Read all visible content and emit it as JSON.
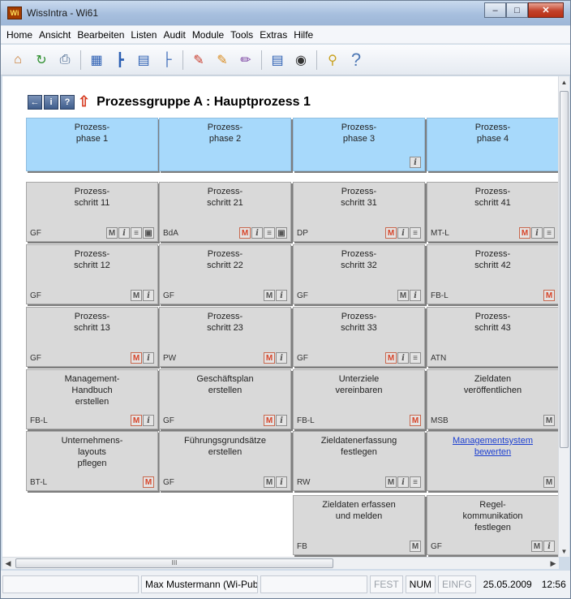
{
  "window": {
    "title": "WissIntra - Wi61"
  },
  "menu": [
    "Home",
    "Ansicht",
    "Bearbeiten",
    "Listen",
    "Audit",
    "Module",
    "Tools",
    "Extras",
    "Hilfe"
  ],
  "toolbar_icons": [
    "home-icon",
    "refresh-icon",
    "print-icon",
    "grid-view-icon",
    "tree-view-icon",
    "list-view-icon",
    "hierarchy-view-icon",
    "pencil-red-icon",
    "pencil-orange-icon",
    "pencil-lines-icon",
    "edit-table-icon",
    "binoculars-icon",
    "key-icon",
    "help-icon"
  ],
  "page": {
    "title": "Prozessgruppe A :  Hauptprozess 1"
  },
  "tiles": [
    {
      "label": "Prozess-\nphase 1",
      "code": "",
      "icons": [],
      "type": "phase"
    },
    {
      "label": "Prozess-\nphase 2",
      "code": "",
      "icons": [],
      "type": "phase"
    },
    {
      "label": "Prozess-\nphase 3",
      "code": "",
      "icons": [
        "i"
      ],
      "type": "phase"
    },
    {
      "label": "Prozess-\nphase 4",
      "code": "",
      "icons": [],
      "type": "phase"
    },
    {
      "label": "Prozess-\nschritt 11",
      "code": "GF",
      "icons": [
        "M",
        "i",
        "list",
        "doc"
      ]
    },
    {
      "label": "Prozess-\nschritt 21",
      "code": "BdA",
      "icons": [
        "M-red",
        "i",
        "list",
        "doc"
      ]
    },
    {
      "label": "Prozess-\nschritt 31",
      "code": "DP",
      "icons": [
        "M-red",
        "i",
        "list"
      ]
    },
    {
      "label": "Prozess-\nschritt 41",
      "code": "MT-L",
      "icons": [
        "M-red",
        "i",
        "list"
      ]
    },
    {
      "label": "Prozess-\nschritt 12",
      "code": "GF",
      "icons": [
        "M",
        "i"
      ]
    },
    {
      "label": "Prozess-\nschritt 22",
      "code": "GF",
      "icons": [
        "M",
        "i"
      ]
    },
    {
      "label": "Prozess-\nschritt 32",
      "code": "GF",
      "icons": [
        "M",
        "i"
      ]
    },
    {
      "label": "Prozess-\nschritt 42",
      "code": "FB-L",
      "icons": [
        "M-red"
      ]
    },
    {
      "label": "Prozess-\nschritt 13",
      "code": "GF",
      "icons": [
        "M-red",
        "i"
      ]
    },
    {
      "label": "Prozess-\nschritt 23",
      "code": "PW",
      "icons": [
        "M-red",
        "i"
      ]
    },
    {
      "label": "Prozess-\nschritt 33",
      "code": "GF",
      "icons": [
        "M-red",
        "i",
        "list"
      ]
    },
    {
      "label": "Prozess-\nschritt 43",
      "code": "ATN",
      "icons": []
    },
    {
      "label": "Management-\nHandbuch\nerstellen",
      "code": "FB-L",
      "icons": [
        "M-red",
        "i"
      ]
    },
    {
      "label": "Geschäftsplan\nerstellen",
      "code": "GF",
      "icons": [
        "M-red",
        "i"
      ]
    },
    {
      "label": "Unterziele\nvereinbaren",
      "code": "FB-L",
      "icons": [
        "M-red"
      ]
    },
    {
      "label": "Zieldaten\nveröffentlichen",
      "code": "MSB",
      "icons": [
        "M"
      ]
    },
    {
      "label": "Unternehmens-\nlayouts\npflegen",
      "code": "BT-L",
      "icons": [
        "M-red"
      ]
    },
    {
      "label": "Führungsgrundsätze\nerstellen",
      "code": "GF",
      "icons": [
        "M",
        "i"
      ]
    },
    {
      "label": "Zieldatenerfassung\nfestlegen",
      "code": "RW",
      "icons": [
        "M",
        "i",
        "list"
      ]
    },
    {
      "label": "Managementsystem\nbewerten",
      "code": "",
      "icons": [
        "M"
      ],
      "link": true
    },
    {
      "label": "Zieldaten erfassen\nund melden",
      "code": "FB",
      "icons": [
        "M"
      ]
    },
    {
      "label": "Regel-\nkommunikation\nfestlegen",
      "code": "GF",
      "icons": [
        "M",
        "i"
      ]
    }
  ],
  "statusbar": {
    "user": "Max Mustermann (Wi-Publi",
    "fest": "FEST",
    "num": "NUM",
    "einfg": "EINFG",
    "date": "25.05.2009",
    "time": "12:56"
  },
  "hscroll_thumb_glyph": "III"
}
